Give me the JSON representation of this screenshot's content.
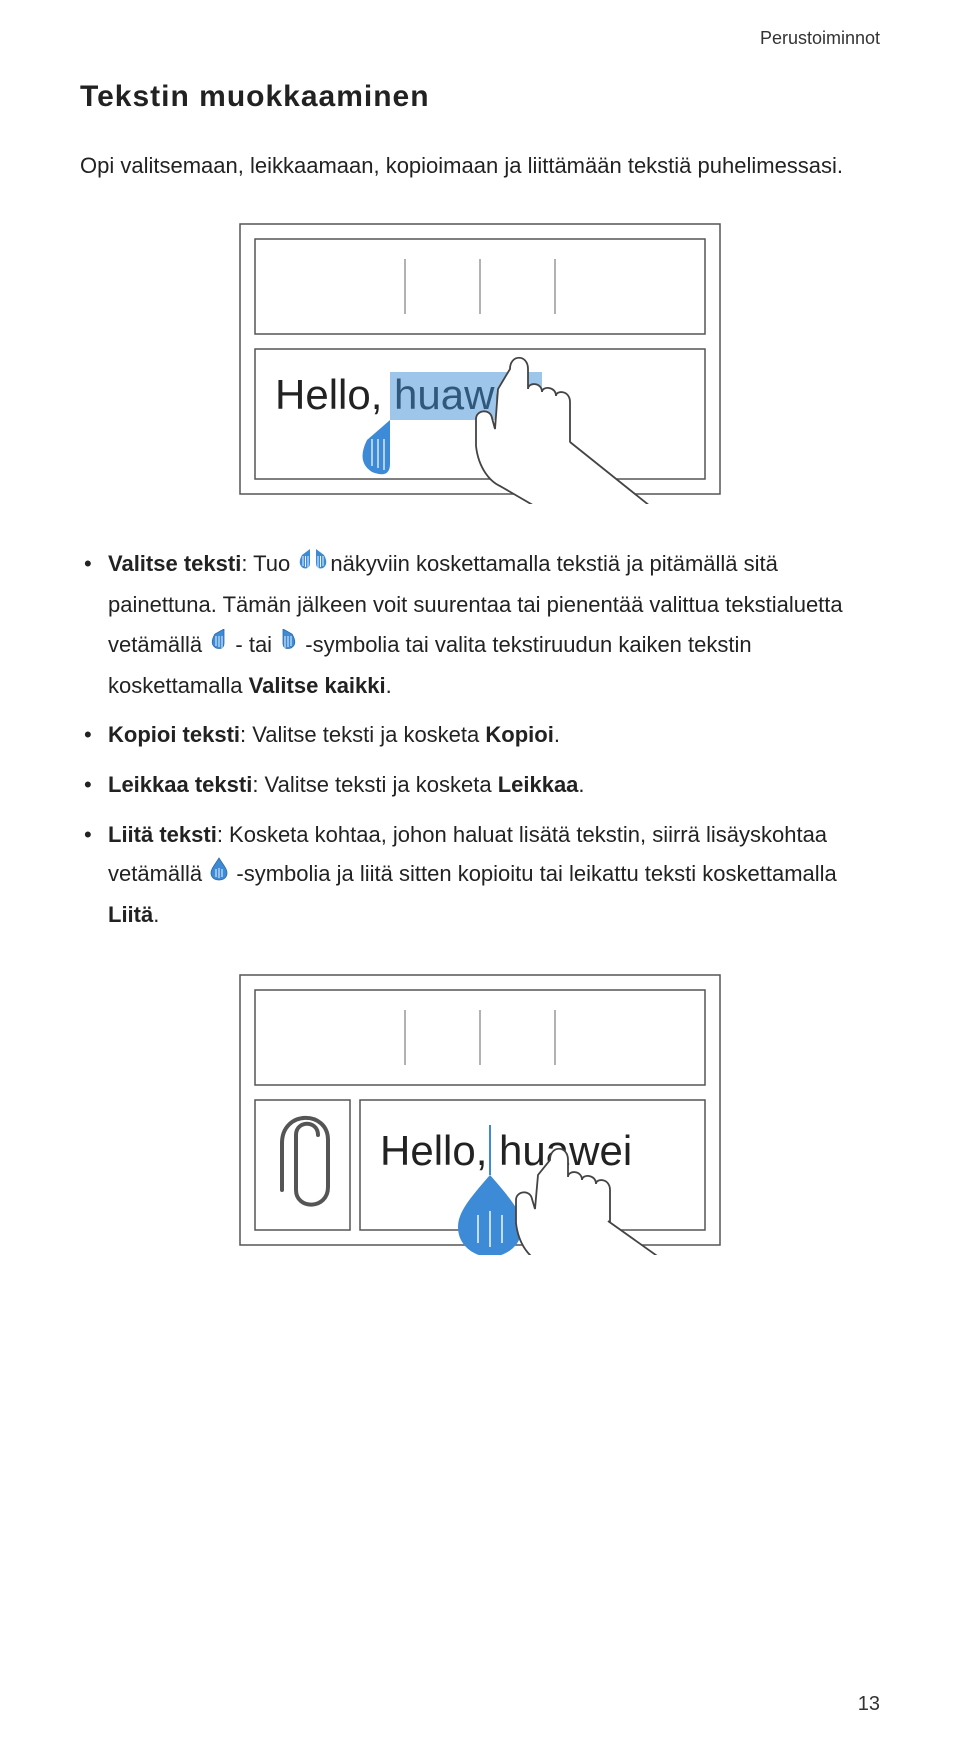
{
  "header": {
    "section": "Perustoiminnot"
  },
  "title": "Tekstin  muokkaaminen",
  "intro": "Opi valitsemaan, leikkaamaan, kopioimaan ja liittämään tekstiä puhelimessasi.",
  "figure1": {
    "text": "Hello, huawei"
  },
  "figure2": {
    "text": "Hello, huawei"
  },
  "bullets": [
    {
      "label": "Valitse teksti",
      "part1": ": Tuo ",
      "part2": "näkyviin koskettamalla tekstiä ja pitämällä sitä painettuna. Tämän jälkeen voit suurentaa tai pienentää valittua tekstialuetta vetämällä ",
      "part3": " - tai ",
      "part4": " -symbolia tai valita tekstiruudun kaiken tekstin koskettamalla ",
      "bold_tail": "Valitse kaikki",
      "tail": "."
    },
    {
      "label": "Kopioi teksti",
      "text": ": Valitse teksti ja kosketa ",
      "bold_tail": "Kopioi",
      "tail": "."
    },
    {
      "label": "Leikkaa teksti",
      "text": ": Valitse teksti ja kosketa ",
      "bold_tail": "Leikkaa",
      "tail": "."
    },
    {
      "label": "Liitä teksti",
      "part1": ": Kosketa kohtaa, johon haluat lisätä tekstin, siirrä lisäyskohtaa vetämällä ",
      "part2": " -symbolia ja liitä sitten kopioitu tai leikattu teksti koskettamalla ",
      "bold_tail": "Liitä",
      "tail": "."
    }
  ],
  "page_number": "13"
}
